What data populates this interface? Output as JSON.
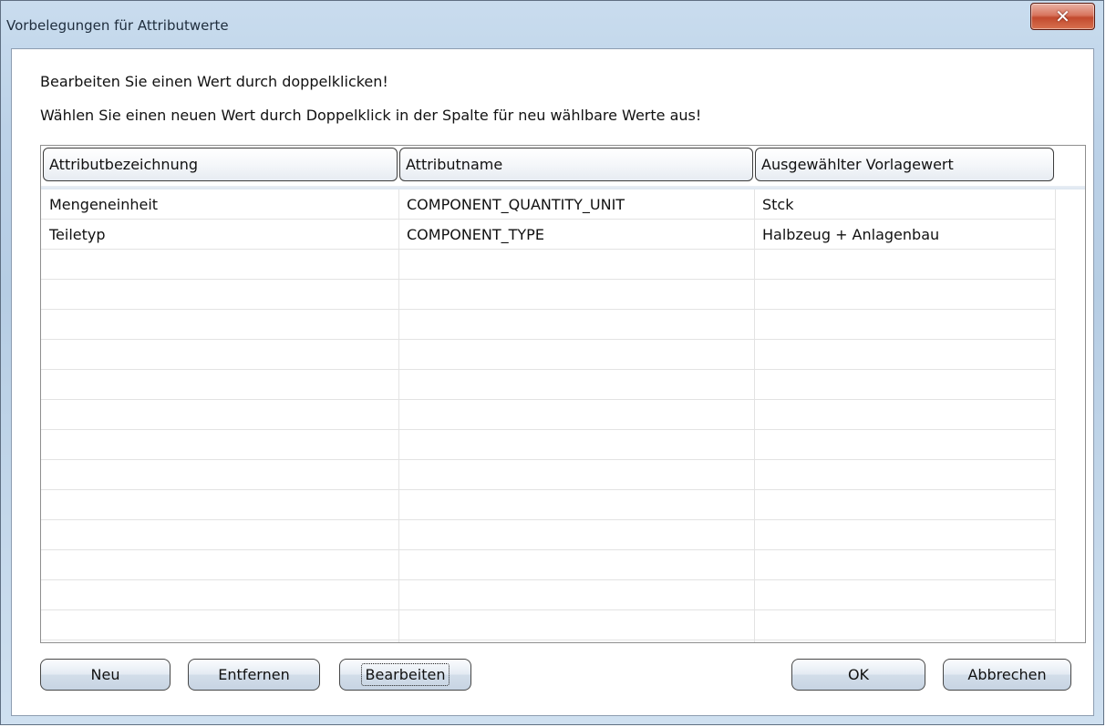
{
  "window": {
    "title": "Vorbelegungen für Attributwerte",
    "close_glyph": "✕"
  },
  "instructions": {
    "line1": "Bearbeiten Sie einen Wert durch doppelklicken!",
    "line2": "Wählen Sie einen neuen Wert durch Doppelklick in der Spalte für neu wählbare Werte aus!"
  },
  "table": {
    "columns": [
      "Attributbezeichnung",
      "Attributname",
      "Ausgewählter Vorlagewert"
    ],
    "rows": [
      [
        "Mengeneinheit",
        "COMPONENT_QUANTITY_UNIT",
        "Stck"
      ],
      [
        "Teiletyp",
        "COMPONENT_TYPE",
        "Halbzeug + Anlagenbau"
      ]
    ]
  },
  "buttons": {
    "new": "Neu",
    "remove": "Entfernen",
    "edit": "Bearbeiten",
    "ok": "OK",
    "cancel": "Abbrechen"
  },
  "colors": {
    "title_bar": "#bcd2e8",
    "close_button": "#c24a2e",
    "button_face": "#e4ebf3"
  }
}
